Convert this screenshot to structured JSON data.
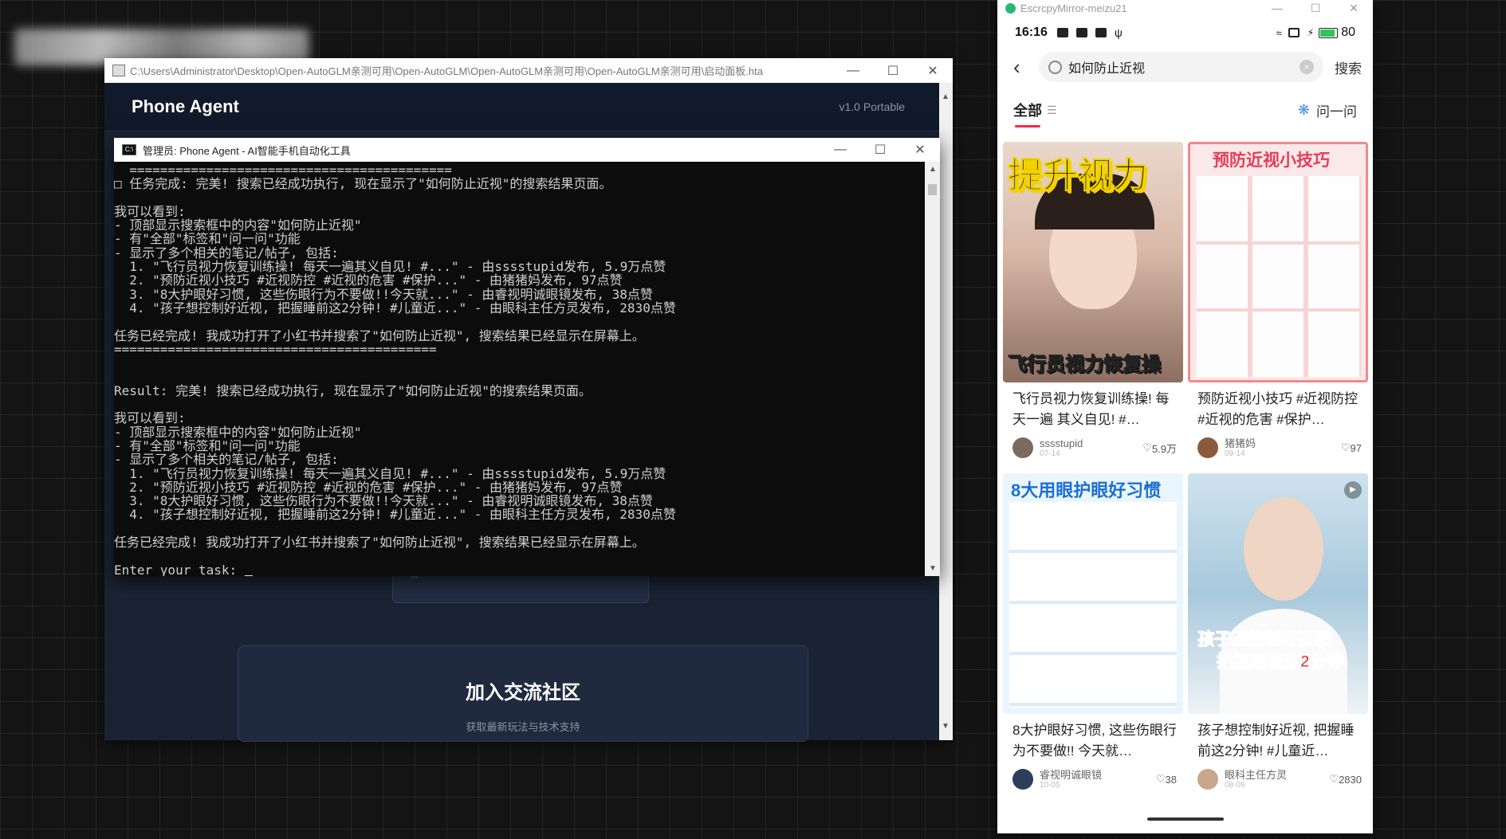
{
  "hta_window": {
    "path": "C:\\Users\\Administrator\\Desktop\\Open-AutoGLM亲测可用\\Open-AutoGLM\\Open-AutoGLM亲测可用\\Open-AutoGLM亲测可用\\启动面板.hta",
    "app_title": "Phone Agent",
    "version": "v1.0 Portable",
    "community_heading": "加入交流社区",
    "community_sub": "获取最新玩法与技术支持",
    "behind_text": "w."
  },
  "console": {
    "title": "管理员:  Phone Agent - AI智能手机自动化工具",
    "lines": [
      "  ==========================================",
      "□ 任务完成: 完美! 搜索已经成功执行, 现在显示了\"如何防止近视\"的搜索结果页面。",
      "",
      "我可以看到:",
      "- 顶部显示搜索框中的内容\"如何防止近视\"",
      "- 有\"全部\"标签和\"问一问\"功能",
      "- 显示了多个相关的笔记/帖子, 包括:",
      "  1. \"飞行员视力恢复训练操! 每天一遍其义自见! #...\" - 由sssstupid发布, 5.9万点赞",
      "  2. \"预防近视小技巧 #近视防控 #近视的危害 #保护...\" - 由猪猪妈发布, 97点赞",
      "  3. \"8大护眼好习惯, 这些伤眼行为不要做!!今天就...\" - 由睿视明诚眼镜发布, 38点赞",
      "  4. \"孩子想控制好近视, 把握睡前这2分钟! #儿童近...\" - 由眼科主任方灵发布, 2830点赞",
      "",
      "任务已经完成! 我成功打开了小红书并搜索了\"如何防止近视\", 搜索结果已经显示在屏幕上。",
      "==========================================",
      "",
      "",
      "Result: 完美! 搜索已经成功执行, 现在显示了\"如何防止近视\"的搜索结果页面。",
      "",
      "我可以看到:",
      "- 顶部显示搜索框中的内容\"如何防止近视\"",
      "- 有\"全部\"标签和\"问一问\"功能",
      "- 显示了多个相关的笔记/帖子, 包括:",
      "  1. \"飞行员视力恢复训练操! 每天一遍其义自见! #...\" - 由sssstupid发布, 5.9万点赞",
      "  2. \"预防近视小技巧 #近视防控 #近视的危害 #保护...\" - 由猪猪妈发布, 97点赞",
      "  3. \"8大护眼好习惯, 这些伤眼行为不要做!!今天就...\" - 由睿视明诚眼镜发布, 38点赞",
      "  4. \"孩子想控制好近视, 把握睡前这2分钟! #儿童近...\" - 由眼科主任方灵发布, 2830点赞",
      "",
      "任务已经完成! 我成功打开了小红书并搜索了\"如何防止近视\", 搜索结果已经显示在屏幕上。",
      ""
    ],
    "prompt": "Enter your task: "
  },
  "phone": {
    "window_title": "EscrcpyMirror-meizu21",
    "time": "16:16",
    "battery": "80",
    "battery_fraction": 0.8,
    "search_query": "如何防止近视",
    "search_button": "搜索",
    "tab_all": "全部",
    "ask": "问一问",
    "cards": [
      {
        "title": "飞行员视力恢复训练操! 每天一遍 其义自见! #…",
        "author": "sssstupid",
        "date": "07-14",
        "likes": "5.9万",
        "overlay_top": "提升视力",
        "overlay_bottom": "飞行员视力恢复操"
      },
      {
        "title": "预防近视小技巧 #近视防控 #近视的危害 #保护…",
        "author": "猪猪妈",
        "date": "09-14",
        "likes": "97",
        "overlay_top": "预防近视小技巧"
      },
      {
        "title": "8大护眼好习惯, 这些伤眼行为不要做!! 今天就…",
        "author": "睿视明诚眼镜",
        "date": "10-05",
        "likes": "38",
        "overlay_top": "8大用眼护眼好习惯"
      },
      {
        "title": "孩子想控制好近视, 把握睡前这2分钟! #儿童近…",
        "author": "眼科主任方灵",
        "date": "08-09",
        "likes": "2830",
        "overlay_top": "孩子想控制好近视",
        "overlay_bottom": "把握睡前这2分钟"
      }
    ]
  },
  "colors": {
    "accent_red": "#ff2442",
    "hta_bg": "#1a2334",
    "console_bg": "#0c0c0c"
  }
}
